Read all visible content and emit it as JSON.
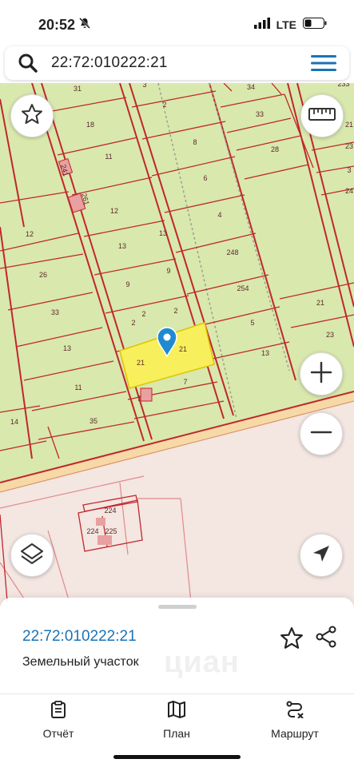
{
  "status_bar": {
    "time": "20:52",
    "network": "LTE",
    "icons": [
      "bell-slash-icon",
      "signal-icon",
      "battery-icon"
    ]
  },
  "search": {
    "value": "22:72:010222:21",
    "icons": [
      "search-icon",
      "menu-icon"
    ]
  },
  "map": {
    "parcel_labels": [
      "31",
      "18",
      "11",
      "12",
      "12",
      "13",
      "9",
      "26",
      "33",
      "13",
      "11",
      "35",
      "14",
      "2",
      "9",
      "2",
      "21",
      "21",
      "7",
      "7",
      "3",
      "2",
      "8",
      "6",
      "4",
      "13",
      "248",
      "254",
      "5",
      "13",
      "34",
      "33",
      "28",
      "21",
      "23",
      "233",
      "21",
      "23",
      "3",
      "24",
      "2",
      "224",
      "224",
      "225",
      "241",
      "261"
    ],
    "highlighted_parcel_label": "21",
    "colors": {
      "land": "#d9e8ad",
      "boundary": "#c0272d",
      "highlight": "#f8ef5c",
      "road": "#f3e6df",
      "marker": "#1f8ad1"
    },
    "buttons": [
      "favorite-button",
      "ruler-button",
      "zoom-in-button",
      "zoom-out-button",
      "layers-button",
      "locate-button"
    ]
  },
  "sheet": {
    "parcel_number": "22:72:010222:21",
    "parcel_type": "Земельный участок",
    "watermark": "циан"
  },
  "tabs": [
    {
      "label": "Отчёт",
      "icon": "report-icon"
    },
    {
      "label": "План",
      "icon": "map-icon"
    },
    {
      "label": "Маршрут",
      "icon": "route-icon"
    }
  ]
}
